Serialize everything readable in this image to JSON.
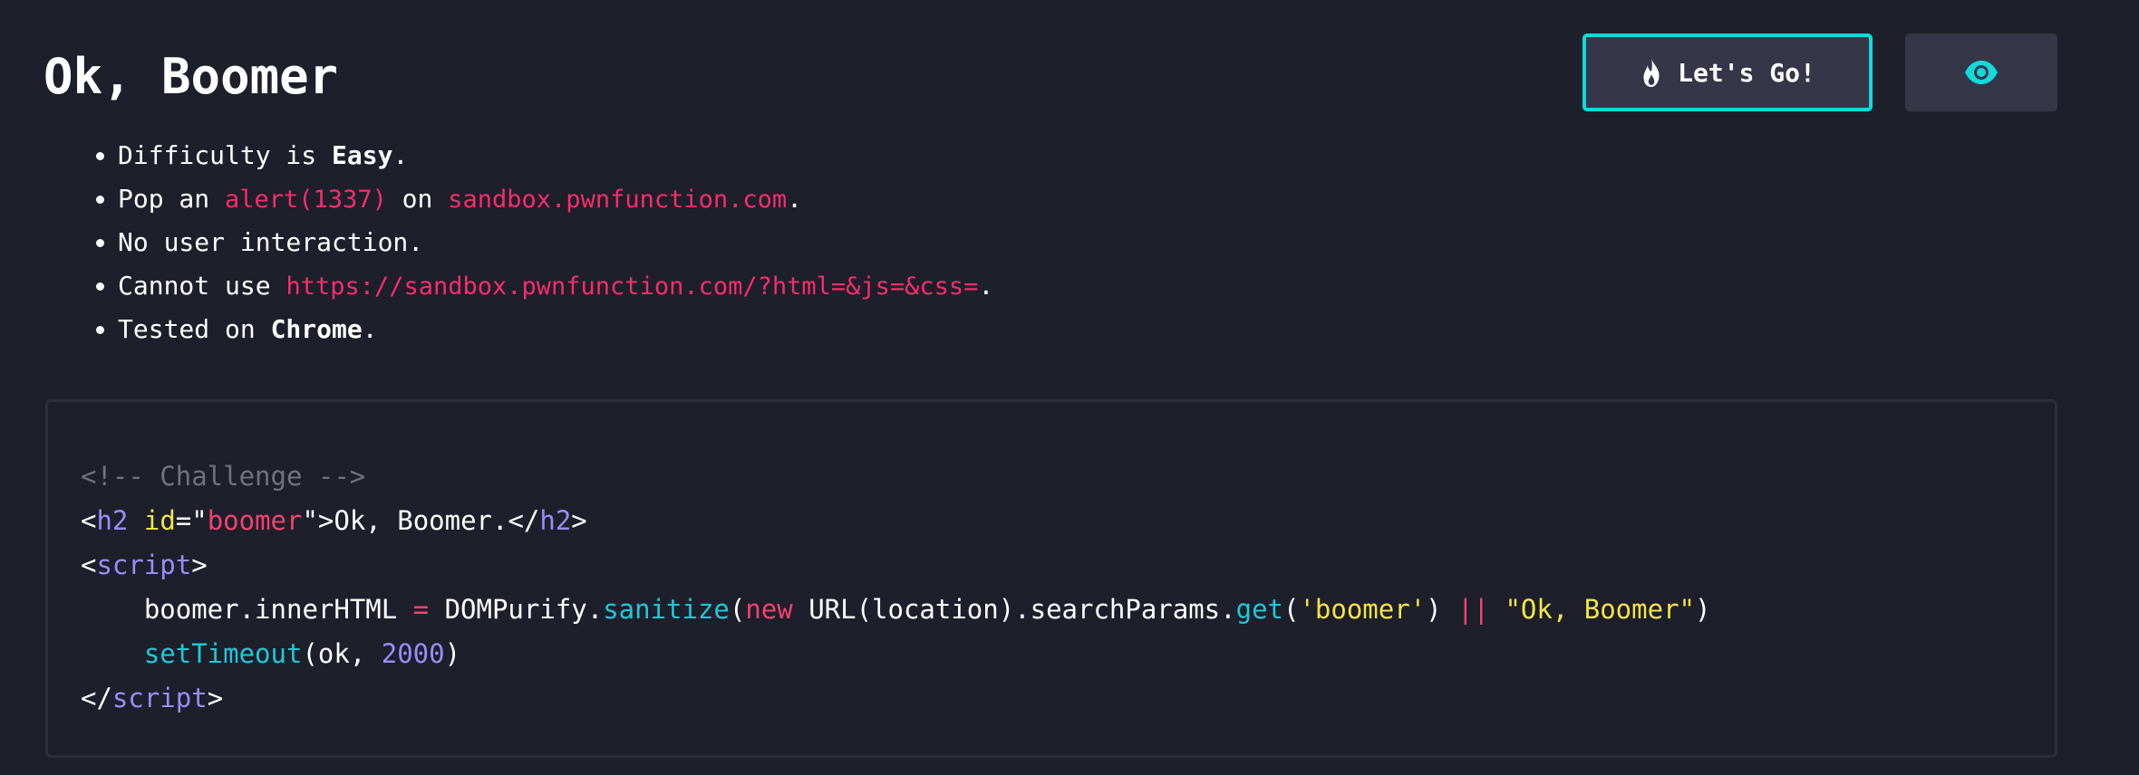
{
  "page": {
    "title": "Ok, Boomer"
  },
  "toolbar": {
    "go_label": "Let's Go!",
    "go_icon": "flame-icon",
    "eye_icon": "eye-icon",
    "accent_color": "#14d8dc"
  },
  "rules": {
    "difficulty_prefix": "Difficulty is ",
    "difficulty_value": "Easy",
    "difficulty_suffix": ".",
    "pop_prefix": "Pop an ",
    "pop_code": "alert(1337)",
    "pop_middle": " on ",
    "pop_domain": "sandbox.pwnfunction.com",
    "pop_suffix": ".",
    "interaction": "No user interaction.",
    "cannot_prefix": "Cannot use ",
    "cannot_url": "https://sandbox.pwnfunction.com/?html=&js=&css=",
    "cannot_suffix": ".",
    "tested_prefix": "Tested on ",
    "tested_value": "Chrome",
    "tested_suffix": "."
  },
  "code": {
    "comment": "<!-- Challenge -->",
    "l2_open": "<",
    "l2_tag": "h2",
    "l2_sp": " ",
    "l2_attr": "id",
    "l2_eq": "=\"",
    "l2_val": "boomer",
    "l2_q": "\">",
    "l2_text": "Ok, Boomer.",
    "l2_close_open": "</",
    "l2_close_tag": "h2",
    "l2_close_end": ">",
    "l3_open": "<",
    "l3_tag": "script",
    "l3_end": ">",
    "l4_indent": "    ",
    "l4_obj": "boomer.innerHTML ",
    "l4_eq": "=",
    "l4_purify": " DOMPurify.",
    "l4_sanitize": "sanitize",
    "l4_paren": "(",
    "l4_new": "new",
    "l4_url": " URL(location).searchParams.",
    "l4_get": "get",
    "l4_paren2": "(",
    "l4_arg": "'boomer'",
    "l4_paren3": ") ",
    "l4_or": "||",
    "l4_sp": " ",
    "l4_default": "\"Ok, Boomer\"",
    "l4_end": ")",
    "l5_indent": "    ",
    "l5_fn": "setTimeout",
    "l5_args": "(ok, ",
    "l5_num": "2000",
    "l5_end": ")",
    "l6_open": "</",
    "l6_tag": "script",
    "l6_end": ">"
  }
}
